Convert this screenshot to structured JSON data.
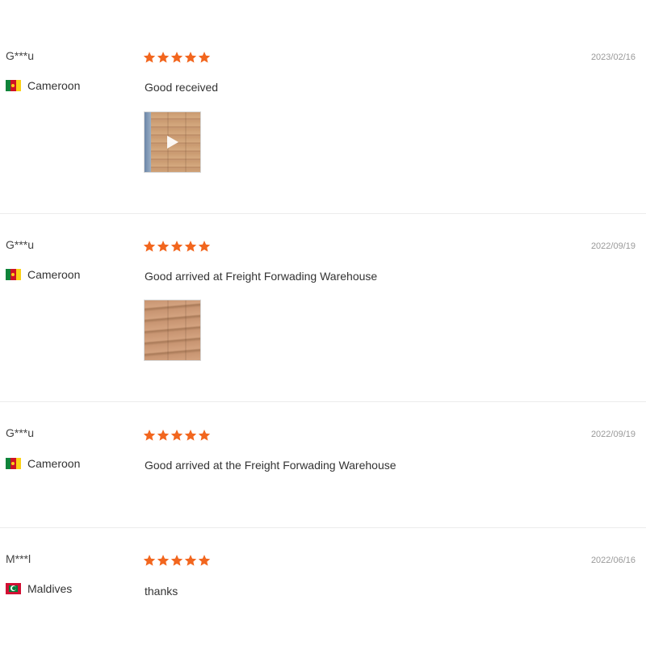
{
  "reviews": [
    {
      "reviewer": "G***u",
      "country": "Cameroon",
      "flag": "cameroon-flag",
      "rating": 5,
      "date": "2023/02/16",
      "comment": "Good received",
      "media": "video-thumbnail"
    },
    {
      "reviewer": "G***u",
      "country": "Cameroon",
      "flag": "cameroon-flag",
      "rating": 5,
      "date": "2022/09/19",
      "comment": "Good arrived at Freight Forwading Warehouse",
      "media": "photo-thumbnail"
    },
    {
      "reviewer": "G***u",
      "country": "Cameroon",
      "flag": "cameroon-flag",
      "rating": 5,
      "date": "2022/09/19",
      "comment": "Good arrived at the Freight Forwading Warehouse"
    },
    {
      "reviewer": "M***l",
      "country": "Maldives",
      "flag": "maldives-flag",
      "rating": 5,
      "date": "2022/06/16",
      "comment": "thanks"
    }
  ],
  "colors": {
    "star": "#f2661e",
    "divider": "#ececec",
    "date": "#999999"
  }
}
